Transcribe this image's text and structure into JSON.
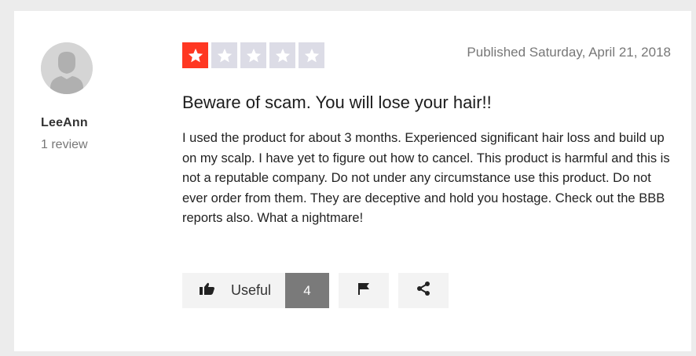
{
  "reviewer": {
    "name": "LeeAnn",
    "review_count": "1 review"
  },
  "review": {
    "rating": 1,
    "rating_max": 5,
    "published": "Published Saturday, April 21, 2018",
    "title": "Beware of scam. You will lose your hair!!",
    "body": "I used the product for about 3 months. Experienced significant hair loss and build up on my scalp. I have yet to figure out how to cancel. This product is harmful and this is not a reputable company. Do not under any circumstance use this product. Do not ever order from them. They are deceptive and hold you hostage. Check out the BBB reports also. What a nightmare!"
  },
  "actions": {
    "useful_label": "Useful",
    "useful_count": "4"
  },
  "icons": {
    "avatar": "user-avatar-icon",
    "star": "star-icon",
    "useful": "thumbs-up-icon",
    "report": "flag-icon",
    "share": "share-icon"
  },
  "colors": {
    "star_active": "#ff3722",
    "star_inactive": "#dcdce6",
    "count_badge": "#7a7a7a"
  }
}
